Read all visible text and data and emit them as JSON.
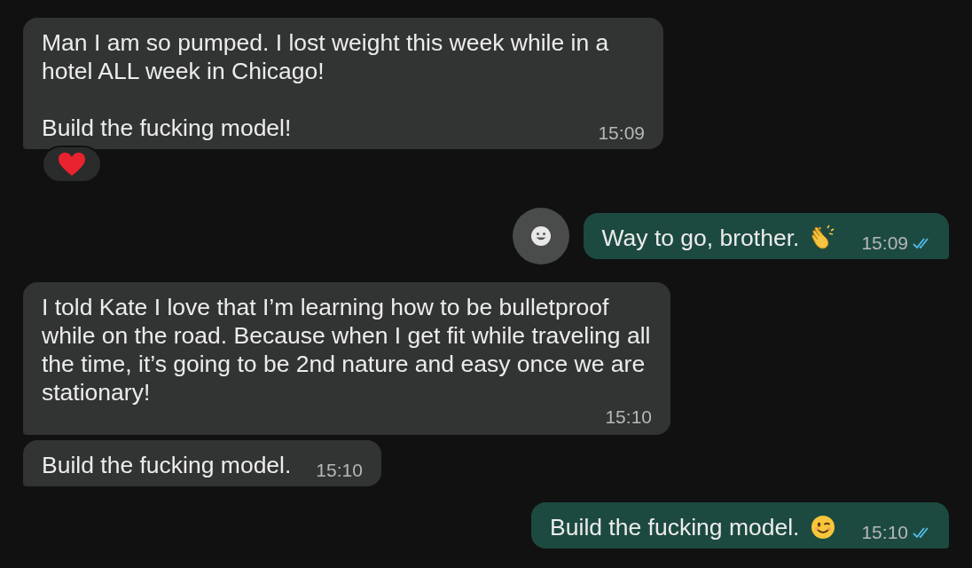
{
  "messages": [
    {
      "kind": "incoming",
      "paragraphs": [
        "Man I am so pumped. I lost weight this week while in a hotel ALL week in Chicago!",
        "Build the fucking model!"
      ],
      "time": "15:09",
      "reaction": {
        "kind": "heart"
      }
    },
    {
      "kind": "outgoing",
      "paragraphs": [
        "Way to go, brother."
      ],
      "emoji": {
        "kind": "clap"
      },
      "time": "15:09",
      "read": true,
      "react_button": true
    },
    {
      "kind": "incoming",
      "paragraphs": [
        "I told Kate I love that I’m learning how to be bulletproof while on the road. Because when I get fit while traveling all the time, it’s going to be 2nd nature and easy once we are stationary!"
      ],
      "time": "15:10"
    },
    {
      "kind": "incoming",
      "paragraphs": [
        "Build the fucking model."
      ],
      "time": "15:10"
    },
    {
      "kind": "outgoing",
      "paragraphs": [
        "Build the fucking model."
      ],
      "emoji": {
        "kind": "wink"
      },
      "time": "15:10",
      "read": true
    }
  ]
}
